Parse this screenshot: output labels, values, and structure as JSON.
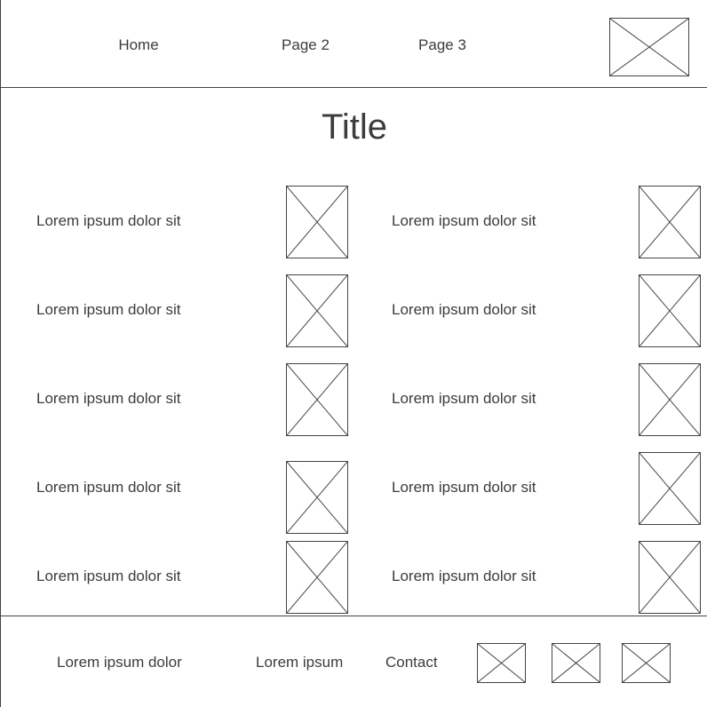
{
  "header": {
    "nav": [
      "Home",
      "Page 2",
      "Page 3"
    ],
    "logo_icon": "image-placeholder-icon"
  },
  "main": {
    "title": "Title",
    "left_items": [
      "Lorem ipsum dolor sit",
      "Lorem ipsum dolor sit",
      "Lorem ipsum dolor sit",
      "Lorem ipsum dolor sit",
      "Lorem ipsum dolor sit"
    ],
    "right_items": [
      "Lorem ipsum dolor sit",
      "Lorem ipsum dolor sit",
      "Lorem ipsum dolor sit",
      "Lorem ipsum dolor sit",
      "Lorem ipsum dolor sit"
    ],
    "item_icon": "image-placeholder-icon"
  },
  "footer": {
    "links": [
      "Lorem ipsum dolor",
      "Lorem ipsum",
      "Contact"
    ],
    "social_icons": [
      "image-placeholder-icon",
      "image-placeholder-icon",
      "image-placeholder-icon"
    ]
  }
}
